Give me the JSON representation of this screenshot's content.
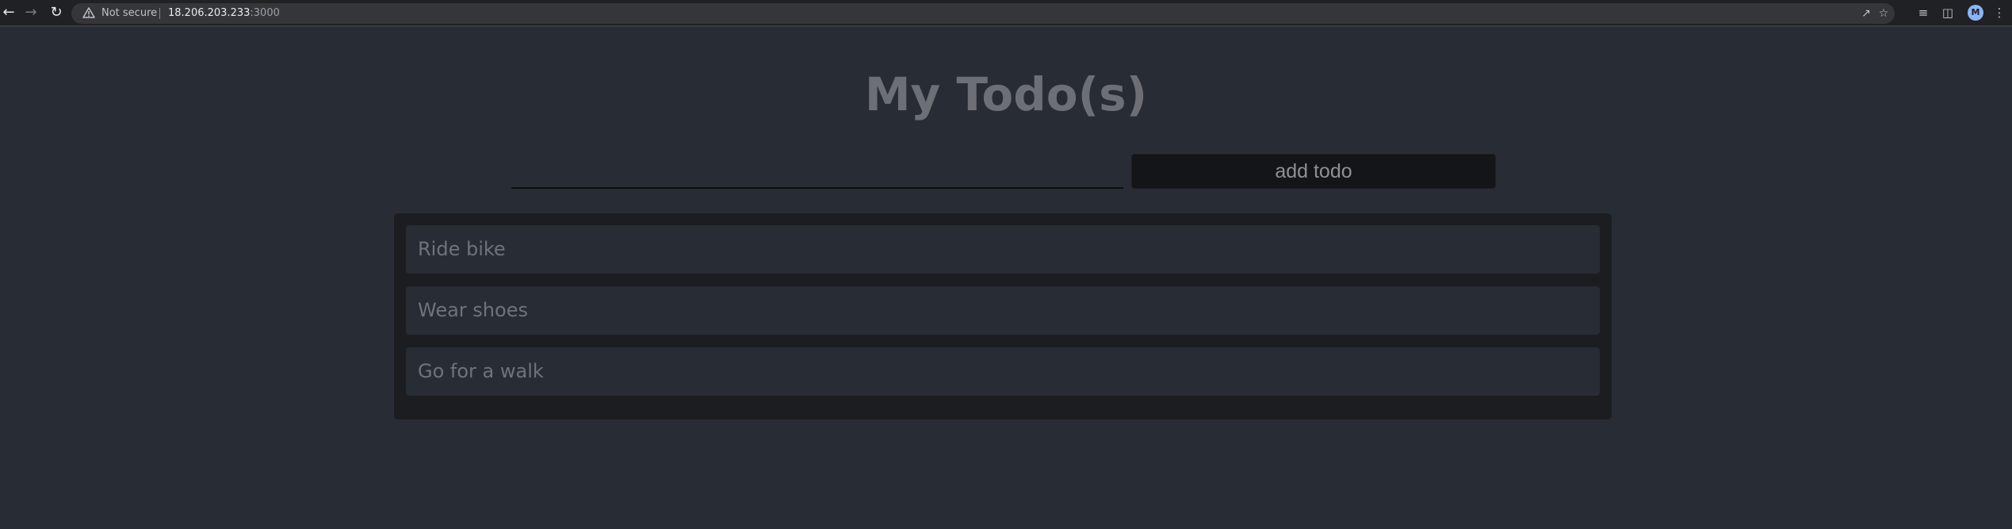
{
  "browser": {
    "security_label": "Not secure",
    "url_host": "18.206.203.233",
    "url_port": ":3000",
    "profile_initial": "M"
  },
  "app": {
    "title": "My Todo(s)",
    "input": {
      "value": "",
      "placeholder": ""
    },
    "add_button_label": "add todo",
    "todos": [
      {
        "text": "Ride bike"
      },
      {
        "text": "Wear shoes"
      },
      {
        "text": "Go for a walk"
      }
    ]
  },
  "colors": {
    "page_background": "#282c34",
    "list_background": "#1b1d21",
    "button_background": "#141518",
    "title_color": "#6c6f75"
  }
}
